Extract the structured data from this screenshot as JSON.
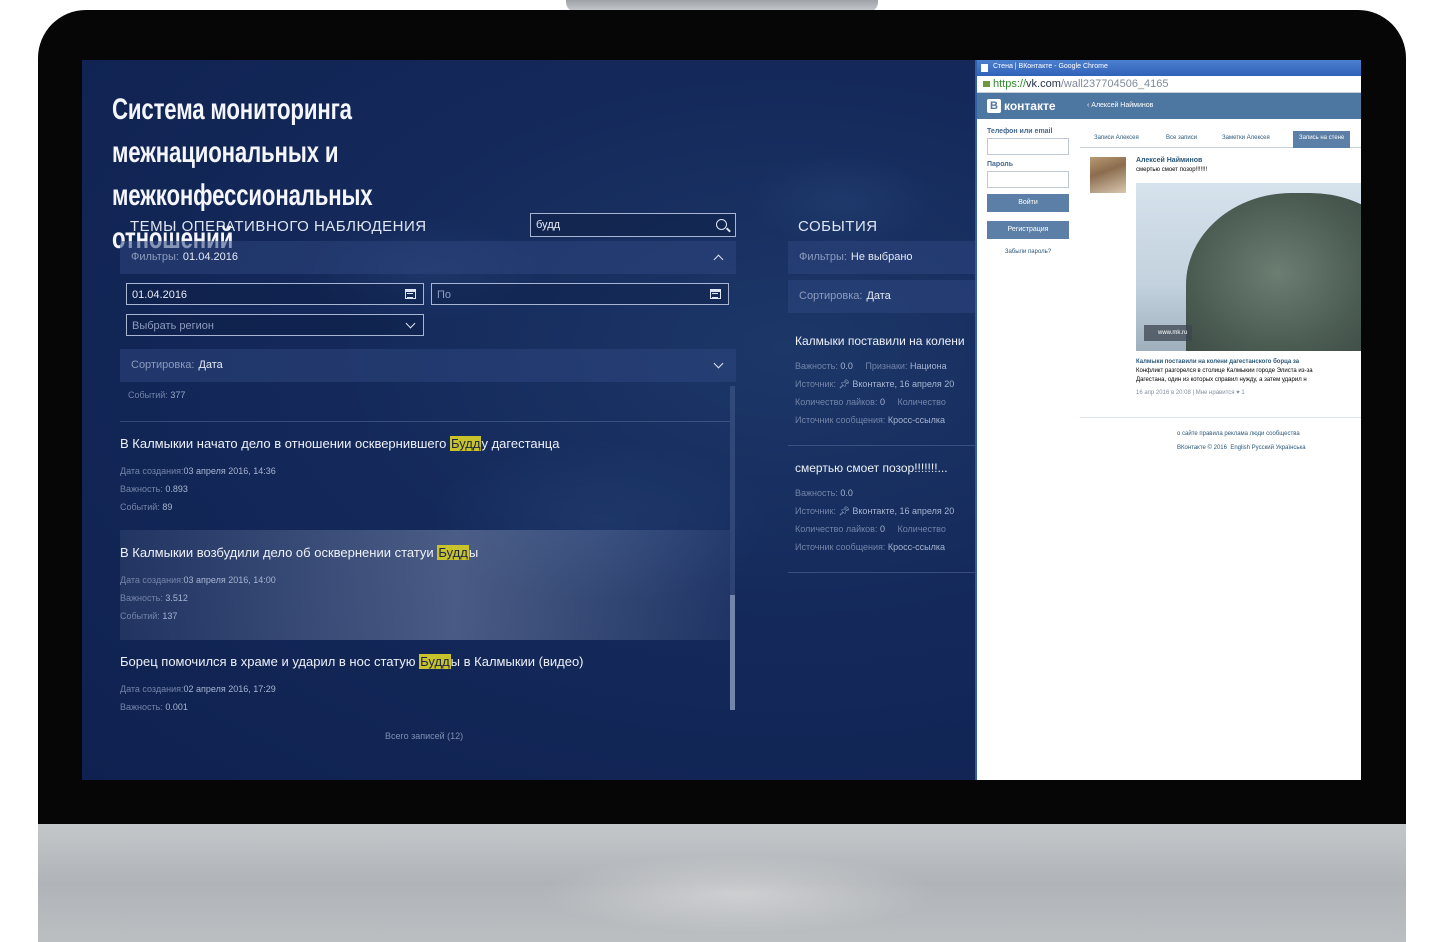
{
  "app": {
    "title": "Система мониторинга межнациональных и межконфессиональных отношений"
  },
  "topics": {
    "title": "ТЕМЫ ОПЕРАТИВНОГО НАБЛЮДЕНИЯ",
    "search_value": "будд",
    "filters_label": "Фильтры:",
    "filters_value": "01.04.2016",
    "date_from": "01.04.2016",
    "date_to_placeholder": "По",
    "region_placeholder": "Выбрать регион",
    "sort_label": "Сортировка:",
    "sort_value": "Дата",
    "events_count_label": "Событий:",
    "events_count_value": "377",
    "items": [
      {
        "title_before": "В Калмыкии начато дело в отношении осквернившего ",
        "title_highlight": "Будд",
        "title_after": "у дагестанца",
        "created_label": "Дата создания:",
        "created": "03 апреля 2016, 14:36",
        "importance_label": "Важность:",
        "importance": "0.893",
        "events_label": "Событий:",
        "events": "89"
      },
      {
        "title_before": "В Калмыкии возбудили дело об осквернении статуи ",
        "title_highlight": "Будд",
        "title_after": "ы",
        "created_label": "Дата создания:",
        "created": "03 апреля 2016, 14:00",
        "importance_label": "Важность:",
        "importance": "3.512",
        "events_label": "Событий:",
        "events": "137"
      },
      {
        "title_before": "Борец помочился в храме и ударил в нос статую ",
        "title_highlight": "Будд",
        "title_after": "ы в Калмыкии (видео)",
        "created_label": "Дата создания:",
        "created": "02 апреля 2016, 17:29",
        "importance_label": "Важность:",
        "importance": "0.001"
      }
    ],
    "total_records": "Всего записей (12)"
  },
  "events": {
    "title": "СОБЫТИЯ",
    "filters_label": "Фильтры:",
    "filters_value": "Не выбрано",
    "sort_label": "Сортировка:",
    "sort_value": "Дата",
    "items": [
      {
        "title": "Калмыки поставили на колени",
        "importance_label": "Важность:",
        "importance": "0.0",
        "signs_label": "Признаки:",
        "signs": "Национа",
        "source_label": "Источник:",
        "source": "Вконтакте, 16 апреля 20",
        "likes_label": "Количество лайков:",
        "likes": "0",
        "count2_label": "Количество",
        "msg_source_label": "Источник сообщения:",
        "msg_source": "Кросс-ссылка"
      },
      {
        "title": "смертью смоет позор!!!!!!!...",
        "importance_label": "Важность:",
        "importance": "0.0",
        "source_label": "Источник:",
        "source": "Вконтакте, 16 апреля 20",
        "likes_label": "Количество лайков:",
        "likes": "0",
        "count2_label": "Количество",
        "msg_source_label": "Источник сообщения:",
        "msg_source": "Кросс-ссылка"
      }
    ]
  },
  "vk": {
    "window_title": "Стена | ВКонтакте - Google Chrome",
    "url_scheme": "https://",
    "url_host": "vk.com",
    "url_path": "/wall237704506_4165",
    "logo_letter": "В",
    "logo_text": "контакте",
    "breadcrumb": "‹ Алексей Найминов",
    "login": {
      "phone_label": "Телефон или email",
      "password_label": "Пароль",
      "login_button": "Войти",
      "register_button": "Регистрация",
      "forgot": "Забыли пароль?"
    },
    "tabs": [
      "Записи Алексея",
      "Все записи",
      "Заметки Алексея",
      "Запись на стене"
    ],
    "post": {
      "author": "Алексей Найминов",
      "text": "смертью смоет позор!!!!!!!",
      "image_tag": "www.mk.ru",
      "caption_title": "Калмыки поставили на колени дагестанского борца за",
      "caption_line1": "Конфликт разгорелся в столице Калмыкии городе Элиста из-за",
      "caption_line2": "Дагестана, один из которых справил нужду, а затем ударил н",
      "date": "16 апр 2016 в 20:08",
      "like": "Мне нравится",
      "like_count": "1"
    },
    "footer": {
      "links": "о сайте   правила   реклама   люди   сообщества",
      "copyright": "ВКонтакте © 2016",
      "langs": "English   Русский   Українська"
    }
  }
}
